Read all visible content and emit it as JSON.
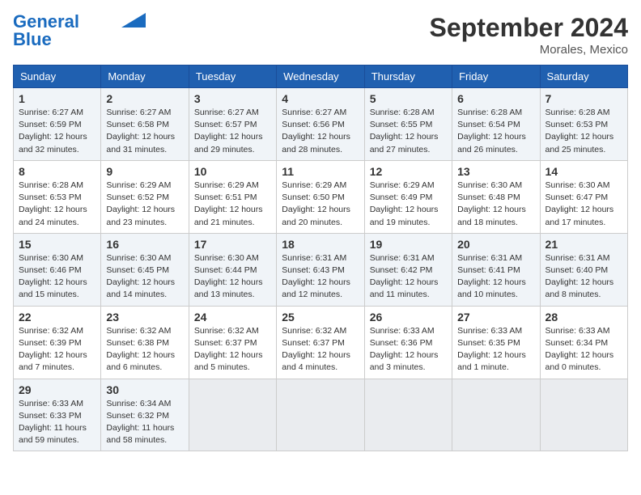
{
  "header": {
    "logo_line1": "General",
    "logo_line2": "Blue",
    "month": "September 2024",
    "location": "Morales, Mexico"
  },
  "days_of_week": [
    "Sunday",
    "Monday",
    "Tuesday",
    "Wednesday",
    "Thursday",
    "Friday",
    "Saturday"
  ],
  "weeks": [
    [
      {
        "day": 1,
        "sunrise": "6:27 AM",
        "sunset": "6:59 PM",
        "daylight": "12 hours and 32 minutes."
      },
      {
        "day": 2,
        "sunrise": "6:27 AM",
        "sunset": "6:58 PM",
        "daylight": "12 hours and 31 minutes."
      },
      {
        "day": 3,
        "sunrise": "6:27 AM",
        "sunset": "6:57 PM",
        "daylight": "12 hours and 29 minutes."
      },
      {
        "day": 4,
        "sunrise": "6:27 AM",
        "sunset": "6:56 PM",
        "daylight": "12 hours and 28 minutes."
      },
      {
        "day": 5,
        "sunrise": "6:28 AM",
        "sunset": "6:55 PM",
        "daylight": "12 hours and 27 minutes."
      },
      {
        "day": 6,
        "sunrise": "6:28 AM",
        "sunset": "6:54 PM",
        "daylight": "12 hours and 26 minutes."
      },
      {
        "day": 7,
        "sunrise": "6:28 AM",
        "sunset": "6:53 PM",
        "daylight": "12 hours and 25 minutes."
      }
    ],
    [
      {
        "day": 8,
        "sunrise": "6:28 AM",
        "sunset": "6:53 PM",
        "daylight": "12 hours and 24 minutes."
      },
      {
        "day": 9,
        "sunrise": "6:29 AM",
        "sunset": "6:52 PM",
        "daylight": "12 hours and 23 minutes."
      },
      {
        "day": 10,
        "sunrise": "6:29 AM",
        "sunset": "6:51 PM",
        "daylight": "12 hours and 21 minutes."
      },
      {
        "day": 11,
        "sunrise": "6:29 AM",
        "sunset": "6:50 PM",
        "daylight": "12 hours and 20 minutes."
      },
      {
        "day": 12,
        "sunrise": "6:29 AM",
        "sunset": "6:49 PM",
        "daylight": "12 hours and 19 minutes."
      },
      {
        "day": 13,
        "sunrise": "6:30 AM",
        "sunset": "6:48 PM",
        "daylight": "12 hours and 18 minutes."
      },
      {
        "day": 14,
        "sunrise": "6:30 AM",
        "sunset": "6:47 PM",
        "daylight": "12 hours and 17 minutes."
      }
    ],
    [
      {
        "day": 15,
        "sunrise": "6:30 AM",
        "sunset": "6:46 PM",
        "daylight": "12 hours and 15 minutes."
      },
      {
        "day": 16,
        "sunrise": "6:30 AM",
        "sunset": "6:45 PM",
        "daylight": "12 hours and 14 minutes."
      },
      {
        "day": 17,
        "sunrise": "6:30 AM",
        "sunset": "6:44 PM",
        "daylight": "12 hours and 13 minutes."
      },
      {
        "day": 18,
        "sunrise": "6:31 AM",
        "sunset": "6:43 PM",
        "daylight": "12 hours and 12 minutes."
      },
      {
        "day": 19,
        "sunrise": "6:31 AM",
        "sunset": "6:42 PM",
        "daylight": "12 hours and 11 minutes."
      },
      {
        "day": 20,
        "sunrise": "6:31 AM",
        "sunset": "6:41 PM",
        "daylight": "12 hours and 10 minutes."
      },
      {
        "day": 21,
        "sunrise": "6:31 AM",
        "sunset": "6:40 PM",
        "daylight": "12 hours and 8 minutes."
      }
    ],
    [
      {
        "day": 22,
        "sunrise": "6:32 AM",
        "sunset": "6:39 PM",
        "daylight": "12 hours and 7 minutes."
      },
      {
        "day": 23,
        "sunrise": "6:32 AM",
        "sunset": "6:38 PM",
        "daylight": "12 hours and 6 minutes."
      },
      {
        "day": 24,
        "sunrise": "6:32 AM",
        "sunset": "6:37 PM",
        "daylight": "12 hours and 5 minutes."
      },
      {
        "day": 25,
        "sunrise": "6:32 AM",
        "sunset": "6:37 PM",
        "daylight": "12 hours and 4 minutes."
      },
      {
        "day": 26,
        "sunrise": "6:33 AM",
        "sunset": "6:36 PM",
        "daylight": "12 hours and 3 minutes."
      },
      {
        "day": 27,
        "sunrise": "6:33 AM",
        "sunset": "6:35 PM",
        "daylight": "12 hours and 1 minute."
      },
      {
        "day": 28,
        "sunrise": "6:33 AM",
        "sunset": "6:34 PM",
        "daylight": "12 hours and 0 minutes."
      }
    ],
    [
      {
        "day": 29,
        "sunrise": "6:33 AM",
        "sunset": "6:33 PM",
        "daylight": "11 hours and 59 minutes."
      },
      {
        "day": 30,
        "sunrise": "6:34 AM",
        "sunset": "6:32 PM",
        "daylight": "11 hours and 58 minutes."
      },
      null,
      null,
      null,
      null,
      null
    ]
  ]
}
